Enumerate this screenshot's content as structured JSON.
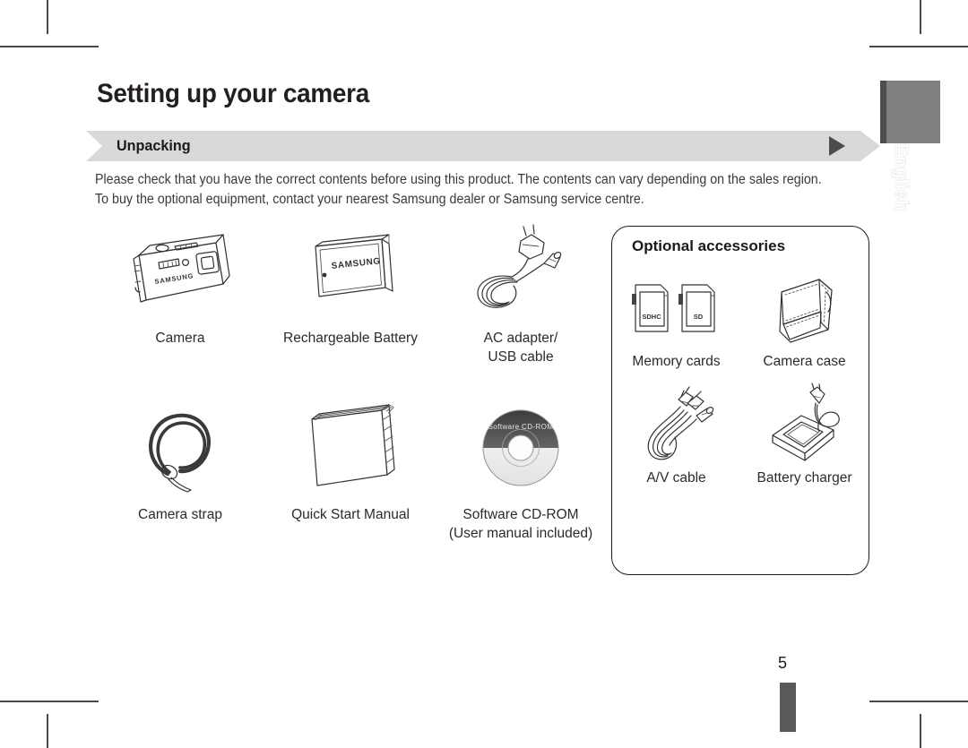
{
  "page": {
    "title": "Setting up your camera",
    "section": "Unpacking",
    "intro_line1": "Please check that you have the correct contents before using this product. The contents can vary depending on the sales region.",
    "intro_line2": "To buy the optional equipment, contact your nearest Samsung dealer or Samsung service centre.",
    "page_number": "5",
    "language_tab": "English"
  },
  "brand": "SAMSUNG",
  "included": {
    "rows": [
      [
        {
          "label": "Camera",
          "icon": "camera-icon",
          "brand": "SAMSUNG"
        },
        {
          "label": "Rechargeable Battery",
          "icon": "battery-icon",
          "brand": "SAMSUNG"
        },
        {
          "label": "AC adapter/\nUSB cable",
          "label_line1": "AC adapter/",
          "label_line2": "USB cable",
          "icon": "ac-adapter-usb-cable-icon"
        }
      ],
      [
        {
          "label": "Camera strap",
          "icon": "camera-strap-icon"
        },
        {
          "label": "Quick Start Manual",
          "icon": "quick-start-manual-icon"
        },
        {
          "label": "Software CD-ROM",
          "label_line1": "Software CD-ROM",
          "label_line2": "(User manual included)",
          "icon": "software-cd-rom-icon",
          "disc_text": "Software CD-ROM"
        }
      ]
    ]
  },
  "optional": {
    "title": "Optional accessories",
    "rows": [
      [
        {
          "label": "Memory cards",
          "icon": "memory-cards-icon",
          "card_labels": [
            "SDHC",
            "SD"
          ]
        },
        {
          "label": "Camera case",
          "icon": "camera-case-icon"
        }
      ],
      [
        {
          "label": "A/V cable",
          "icon": "av-cable-icon"
        },
        {
          "label": "Battery charger",
          "icon": "battery-charger-icon"
        }
      ]
    ]
  },
  "colors": {
    "section_bar": "#d9d9d9",
    "tab": "#808080",
    "tab_edge": "#4d4d4d",
    "text": "#2b2b2b",
    "footer_bar": "#595959"
  }
}
